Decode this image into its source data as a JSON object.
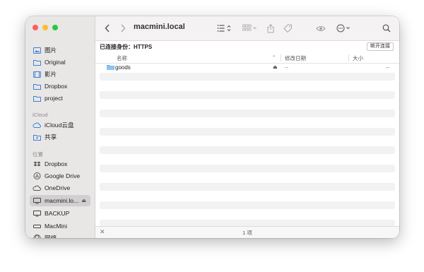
{
  "window": {
    "title": "macmini.local"
  },
  "sidebar": {
    "items_top": [
      {
        "label": "图片",
        "icon": "photos-icon"
      },
      {
        "label": "Original",
        "icon": "folder-icon"
      },
      {
        "label": "影片",
        "icon": "movies-icon"
      },
      {
        "label": "Dropbox",
        "icon": "folder-icon"
      },
      {
        "label": "project",
        "icon": "folder-icon"
      }
    ],
    "section_icloud": "iCloud",
    "items_icloud": [
      {
        "label": "iCloud云盘",
        "icon": "cloud-icon"
      },
      {
        "label": "共享",
        "icon": "shared-folder-icon"
      }
    ],
    "section_locations": "位置",
    "items_locations": [
      {
        "label": "Dropbox",
        "icon": "dropbox-icon"
      },
      {
        "label": "Google Drive",
        "icon": "drive-icon"
      },
      {
        "label": "OneDrive",
        "icon": "cloud-icon"
      },
      {
        "label": "macmini.lo...",
        "icon": "display-icon",
        "selected": true
      },
      {
        "label": "BACKUP",
        "icon": "display-icon"
      },
      {
        "label": "MacMini",
        "icon": "macmini-icon"
      },
      {
        "label": "网络",
        "icon": "network-icon"
      }
    ]
  },
  "connection": {
    "status": "已连接身份：HTTPS",
    "disconnect_label": "断开连接"
  },
  "columns": {
    "name": "名称",
    "modified": "修改日期",
    "size": "大小"
  },
  "files": [
    {
      "name": "goods",
      "modified": "--",
      "size": "--"
    }
  ],
  "status": {
    "count": "1 项"
  }
}
